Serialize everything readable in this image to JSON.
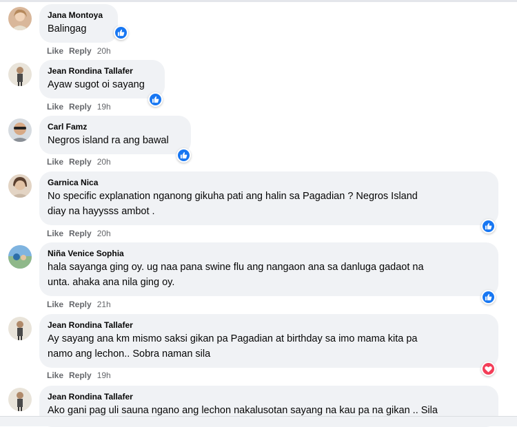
{
  "actions": {
    "like": "Like",
    "reply": "Reply"
  },
  "comments": [
    {
      "name": "Jana Montoya",
      "lines": [
        "Balingag"
      ],
      "time": "20h",
      "reaction": "like-icon"
    },
    {
      "name": "Jean Rondina Tallafer",
      "lines": [
        "Ayaw sugot oi sayang"
      ],
      "time": "19h",
      "reaction": "like-icon"
    },
    {
      "name": "Carl Famz",
      "lines": [
        "Negros island ra ang bawal"
      ],
      "time": "20h",
      "reaction": "like-icon"
    },
    {
      "name": "Garnica Nica",
      "lines": [
        "No specific explanation nganong gikuha pati ang halin sa Pagadian ? Negros Island",
        "diay na hayysss ambot ."
      ],
      "time": "20h",
      "reaction": "like-icon"
    },
    {
      "name": "Niña Venice Sophia",
      "lines": [
        "hala sayanga ging oy. ug naa pana swine flu ang nangaon ana sa danluga gadaot na",
        "unta. ahaka ana nila ging oy."
      ],
      "time": "21h",
      "reaction": "like-icon"
    },
    {
      "name": "Jean Rondina Tallafer",
      "lines": [
        "Ay sayang ana km mismo saksi gikan pa Pagadian at birthday sa imo mama kita pa",
        "namo ang lechon.. Sobra naman sila"
      ],
      "time": "19h",
      "reaction": "heart-icon"
    },
    {
      "name": "Jean Rondina Tallafer",
      "lines": [
        "Ako gani pag uli sauna ngano ang lechon nakalusotan sayang na kau pa na gikan .. Sila"
      ],
      "time": "",
      "reaction": ""
    }
  ],
  "colors": {
    "like": "#1877f2",
    "love": "#f33e58",
    "bubble": "#f0f2f5",
    "meta": "#65676b"
  }
}
